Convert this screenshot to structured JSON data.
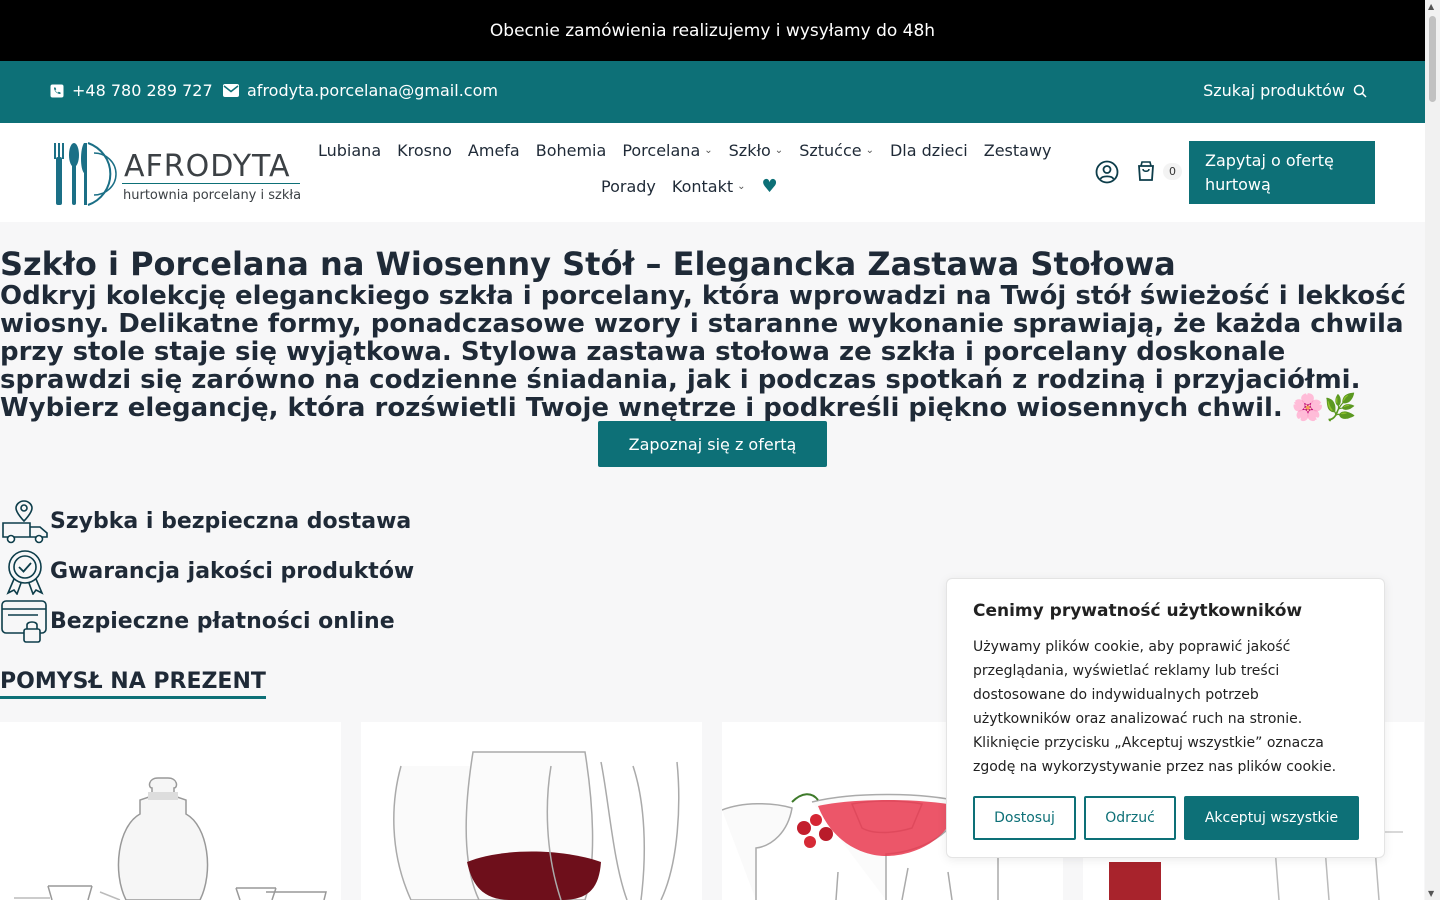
{
  "announcement": "Obecnie zamówienia realizujemy i wysyłamy do 48h",
  "contact": {
    "phone": "+48 780 289 727",
    "email": "afrodyta.porcelana@gmail.com",
    "search_label": "Szukaj produktów"
  },
  "logo": {
    "word": "AFRODYTA",
    "subtitle": "hurtownia porcelany i szkła"
  },
  "nav": {
    "row1": [
      "Lubiana",
      "Krosno",
      "Amefa",
      "Bohemia",
      "Porcelana",
      "Szkło",
      "Sztućce",
      "Dla dzieci",
      "Zestawy"
    ],
    "row2": [
      "Porady",
      "Kontakt"
    ]
  },
  "cart": {
    "count": "0"
  },
  "cta_quote": "Zapytaj o ofertę hurtową",
  "hero": {
    "title": "Szkło i Porcelana na Wiosenny Stół – Elegancka Zastawa Stołowa",
    "text": "Odkryj kolekcję eleganckiego szkła i porcelany, która wprowadzi na Twój stół świeżość i lekkość wiosny. Delikatne formy, ponadczasowe wzory i staranne wykonanie sprawiają, że każda chwila przy stole staje się wyjątkowa. Stylowa zastawa stołowa ze szkła i porcelany doskonale sprawdzi się zarówno na codzienne śniadania, jak i podczas spotkań z rodziną i przyjaciółmi. Wybierz elegancję, która rozświetli Twoje wnętrze i podkreśli piękno wiosennych chwil. ",
    "emoji": "🌸🌿",
    "button": "Zapoznaj się z ofertą"
  },
  "features": [
    {
      "label": "Szybka i bezpieczna dostawa",
      "icon": "delivery-truck-icon"
    },
    {
      "label": "Gwarancja jakości produktów",
      "icon": "quality-badge-icon"
    },
    {
      "label": "Bezpieczne płatności online",
      "icon": "secure-payment-icon"
    }
  ],
  "section_title": "POMYSŁ NA PREZENT",
  "cookie": {
    "title": "Cenimy prywatność użytkowników",
    "text": "Używamy plików cookie, aby poprawić jakość przeglądania, wyświetlać reklamy lub treści dostosowane do indywidualnych potrzeb użytkowników oraz analizować ruch na stronie. Kliknięcie przycisku „Akceptuj wszystkie” oznacza zgodę na wykorzystywanie przez nas plików cookie.",
    "customize": "Dostosuj",
    "reject": "Odrzuć",
    "accept": "Akceptuj wszystkie"
  },
  "colors": {
    "brand": "#0d7077",
    "topbar": "#000000",
    "text": "#1f2a37"
  }
}
